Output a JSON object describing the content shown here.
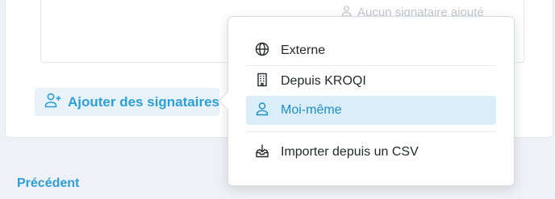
{
  "signers": {
    "empty_hint": "Aucun signataire ajouté",
    "add_button_label": "Ajouter des signataires"
  },
  "navigation": {
    "previous_label": "Précédent"
  },
  "menu": {
    "items": [
      {
        "label": "Externe",
        "icon": "globe-icon"
      },
      {
        "label": "Depuis KROQI",
        "icon": "building-icon"
      },
      {
        "label": "Moi-même",
        "icon": "user-icon",
        "active": true
      },
      {
        "label": "Importer depuis un CSV",
        "icon": "import-tray-icon"
      }
    ]
  },
  "colors": {
    "accent": "#2d9fd6",
    "active_bg": "#d9eef9",
    "button_bg": "#e8f2f9"
  }
}
